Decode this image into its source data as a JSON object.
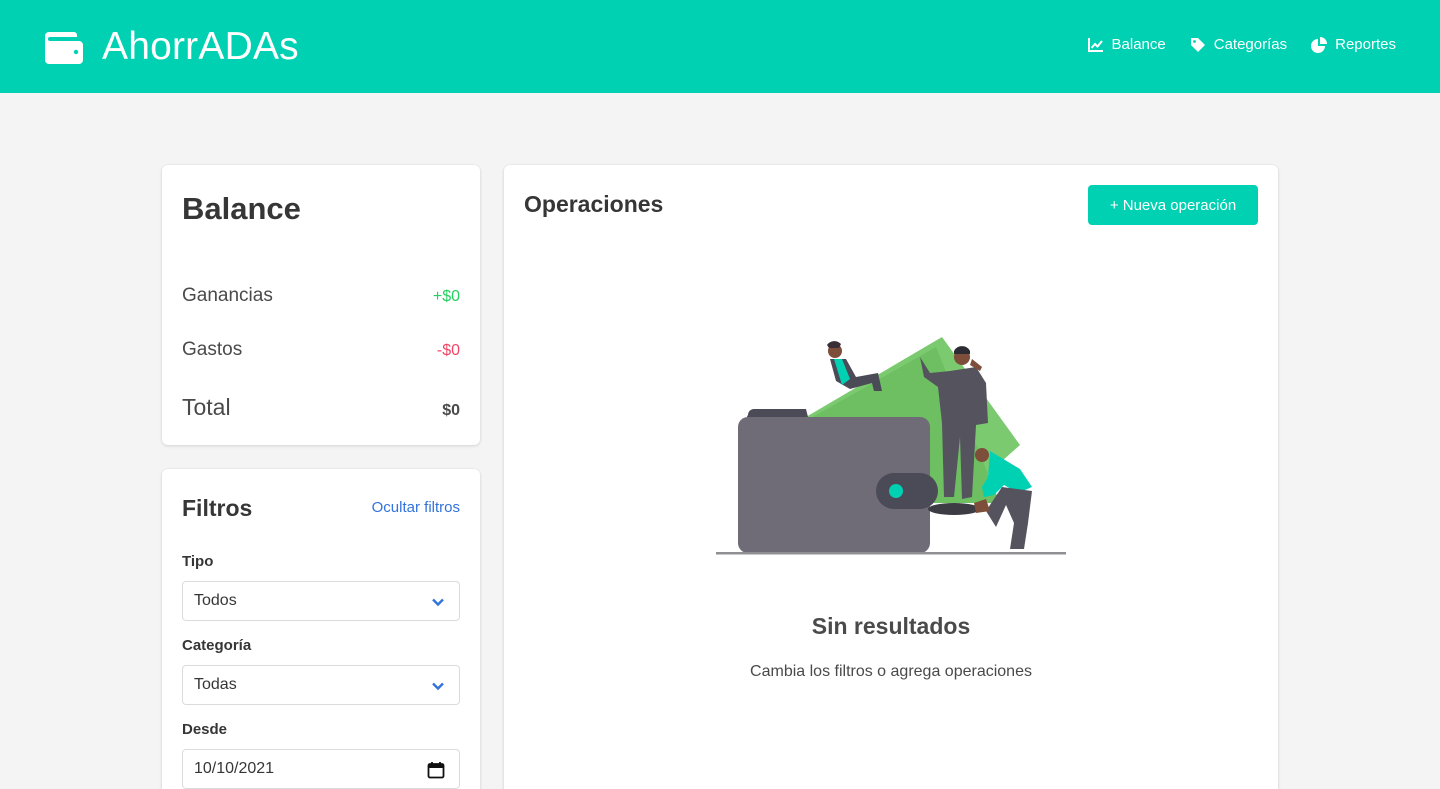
{
  "app": {
    "title": "AhorrADAs",
    "brand_icon": "wallet-icon",
    "accent": "#00d1b2"
  },
  "nav": {
    "items": [
      {
        "label": "Balance",
        "icon": "chart-line-icon"
      },
      {
        "label": "Categorías",
        "icon": "tag-icon"
      },
      {
        "label": "Reportes",
        "icon": "pie-chart-icon"
      }
    ]
  },
  "balance": {
    "title": "Balance",
    "rows": [
      {
        "label": "Ganancias",
        "value": "+$0",
        "color": "#23d160"
      },
      {
        "label": "Gastos",
        "value": "-$0",
        "color": "#f14668"
      },
      {
        "label": "Total",
        "value": "$0"
      }
    ]
  },
  "filters": {
    "title": "Filtros",
    "toggle_label": "Ocultar filtros",
    "tipo": {
      "label": "Tipo",
      "value": "Todos"
    },
    "categoria": {
      "label": "Categoría",
      "value": "Todas"
    },
    "desde": {
      "label": "Desde",
      "value": "10/10/2021"
    }
  },
  "operations": {
    "title": "Operaciones",
    "new_button": "+ Nueva operación",
    "empty_title": "Sin resultados",
    "empty_subtitle": "Cambia los filtros o agrega operaciones"
  }
}
